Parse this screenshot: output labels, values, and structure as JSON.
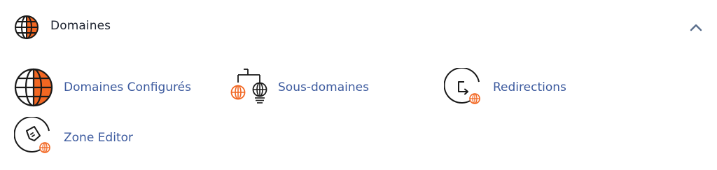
{
  "colors": {
    "accent": "#f26722",
    "ink": "#1a1a1a",
    "link": "#3c5a9e",
    "title": "#1d2330"
  },
  "section": {
    "title": "Domaines",
    "icon": "globe-icon",
    "collapse_icon": "chevron-up-icon"
  },
  "tools": [
    {
      "label": "Domaines Configurés",
      "icon": "globe-icon"
    },
    {
      "label": "Sous-domaines",
      "icon": "subdomains-tree-icon"
    },
    {
      "label": "Redirections",
      "icon": "redirect-icon"
    },
    {
      "label": "Zone Editor",
      "icon": "zone-editor-icon"
    }
  ]
}
